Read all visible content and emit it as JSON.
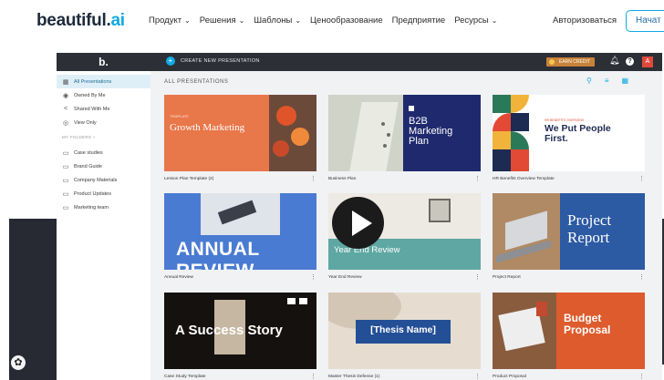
{
  "site": {
    "logo_main": "beautiful.",
    "logo_ai": "ai",
    "nav": [
      "Продукт",
      "Решения",
      "Шаблоны",
      "Ценообразование",
      "Предприятие",
      "Ресурсы"
    ],
    "nav_has_chevron": [
      true,
      true,
      true,
      false,
      false,
      true
    ],
    "login": "Авторизоваться",
    "start": "Начат"
  },
  "app": {
    "logo": "b.",
    "create_label": "CREATE NEW PRESENTATION",
    "earn_label": "EARN CREDIT",
    "avatar_initial": "A"
  },
  "sidebar": {
    "items": [
      {
        "label": "All Presentations",
        "icon": "grid-icon",
        "active": true
      },
      {
        "label": "Owned By Me",
        "icon": "user-icon"
      },
      {
        "label": "Shared With Me",
        "icon": "share-icon"
      },
      {
        "label": "View Only",
        "icon": "eye-icon"
      }
    ],
    "folders_heading": "MY FOLDERS",
    "folders": [
      "Case studies",
      "Brand Guide",
      "Company Materials",
      "Product Updates",
      "Marketing team"
    ]
  },
  "main": {
    "heading": "ALL PRESENTATIONS"
  },
  "cards": [
    {
      "title": "Lesson Plan Template (2)",
      "thumb_text": "Growth Marketing",
      "thumb_small": "TEMPLATE"
    },
    {
      "title": "Business Plan",
      "thumb_text": "B2B Marketing Plan"
    },
    {
      "title": "HR Benefits Overview Template",
      "thumb_text": "We Put People First.",
      "thumb_small": "HR BENEFITS OVERVIEW"
    },
    {
      "title": "Annual Review",
      "thumb_text": "ANNUAL REVIEW"
    },
    {
      "title": "Year End Review",
      "thumb_text": "Year End Review"
    },
    {
      "title": "Project Report",
      "thumb_text": "Project Report"
    },
    {
      "title": "Case Study Template",
      "thumb_text": "A Success Story"
    },
    {
      "title": "Master Thesis Defense (1)",
      "thumb_text": "[Thesis Name]"
    },
    {
      "title": "Product Proposal",
      "thumb_text": "Budget Proposal"
    }
  ],
  "colors": {
    "brand_blue": "#11a9e2",
    "app_bar": "#2c2f36",
    "earn_orange": "#c8833a"
  }
}
